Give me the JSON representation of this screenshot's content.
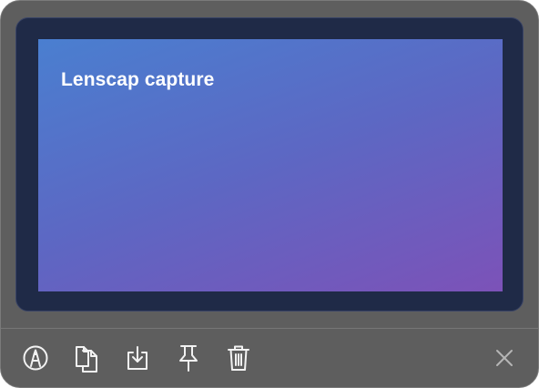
{
  "capture": {
    "title": "Lenscap capture",
    "gradient_colors": [
      "#4a7fd0",
      "#5d67c3",
      "#7c52b8"
    ]
  },
  "toolbar": {
    "tools": [
      {
        "id": "annotate",
        "icon": "annotate-icon"
      },
      {
        "id": "copy",
        "icon": "copy-icon"
      },
      {
        "id": "save",
        "icon": "save-icon"
      },
      {
        "id": "pin",
        "icon": "pin-icon"
      },
      {
        "id": "delete",
        "icon": "trash-icon"
      },
      {
        "id": "close",
        "icon": "close-icon"
      }
    ]
  },
  "colors": {
    "window_bg": "#5e5e5e",
    "frame_bg": "#1f2a47",
    "icon": "#f2f2f2",
    "close_icon": "#b5b5b5"
  }
}
